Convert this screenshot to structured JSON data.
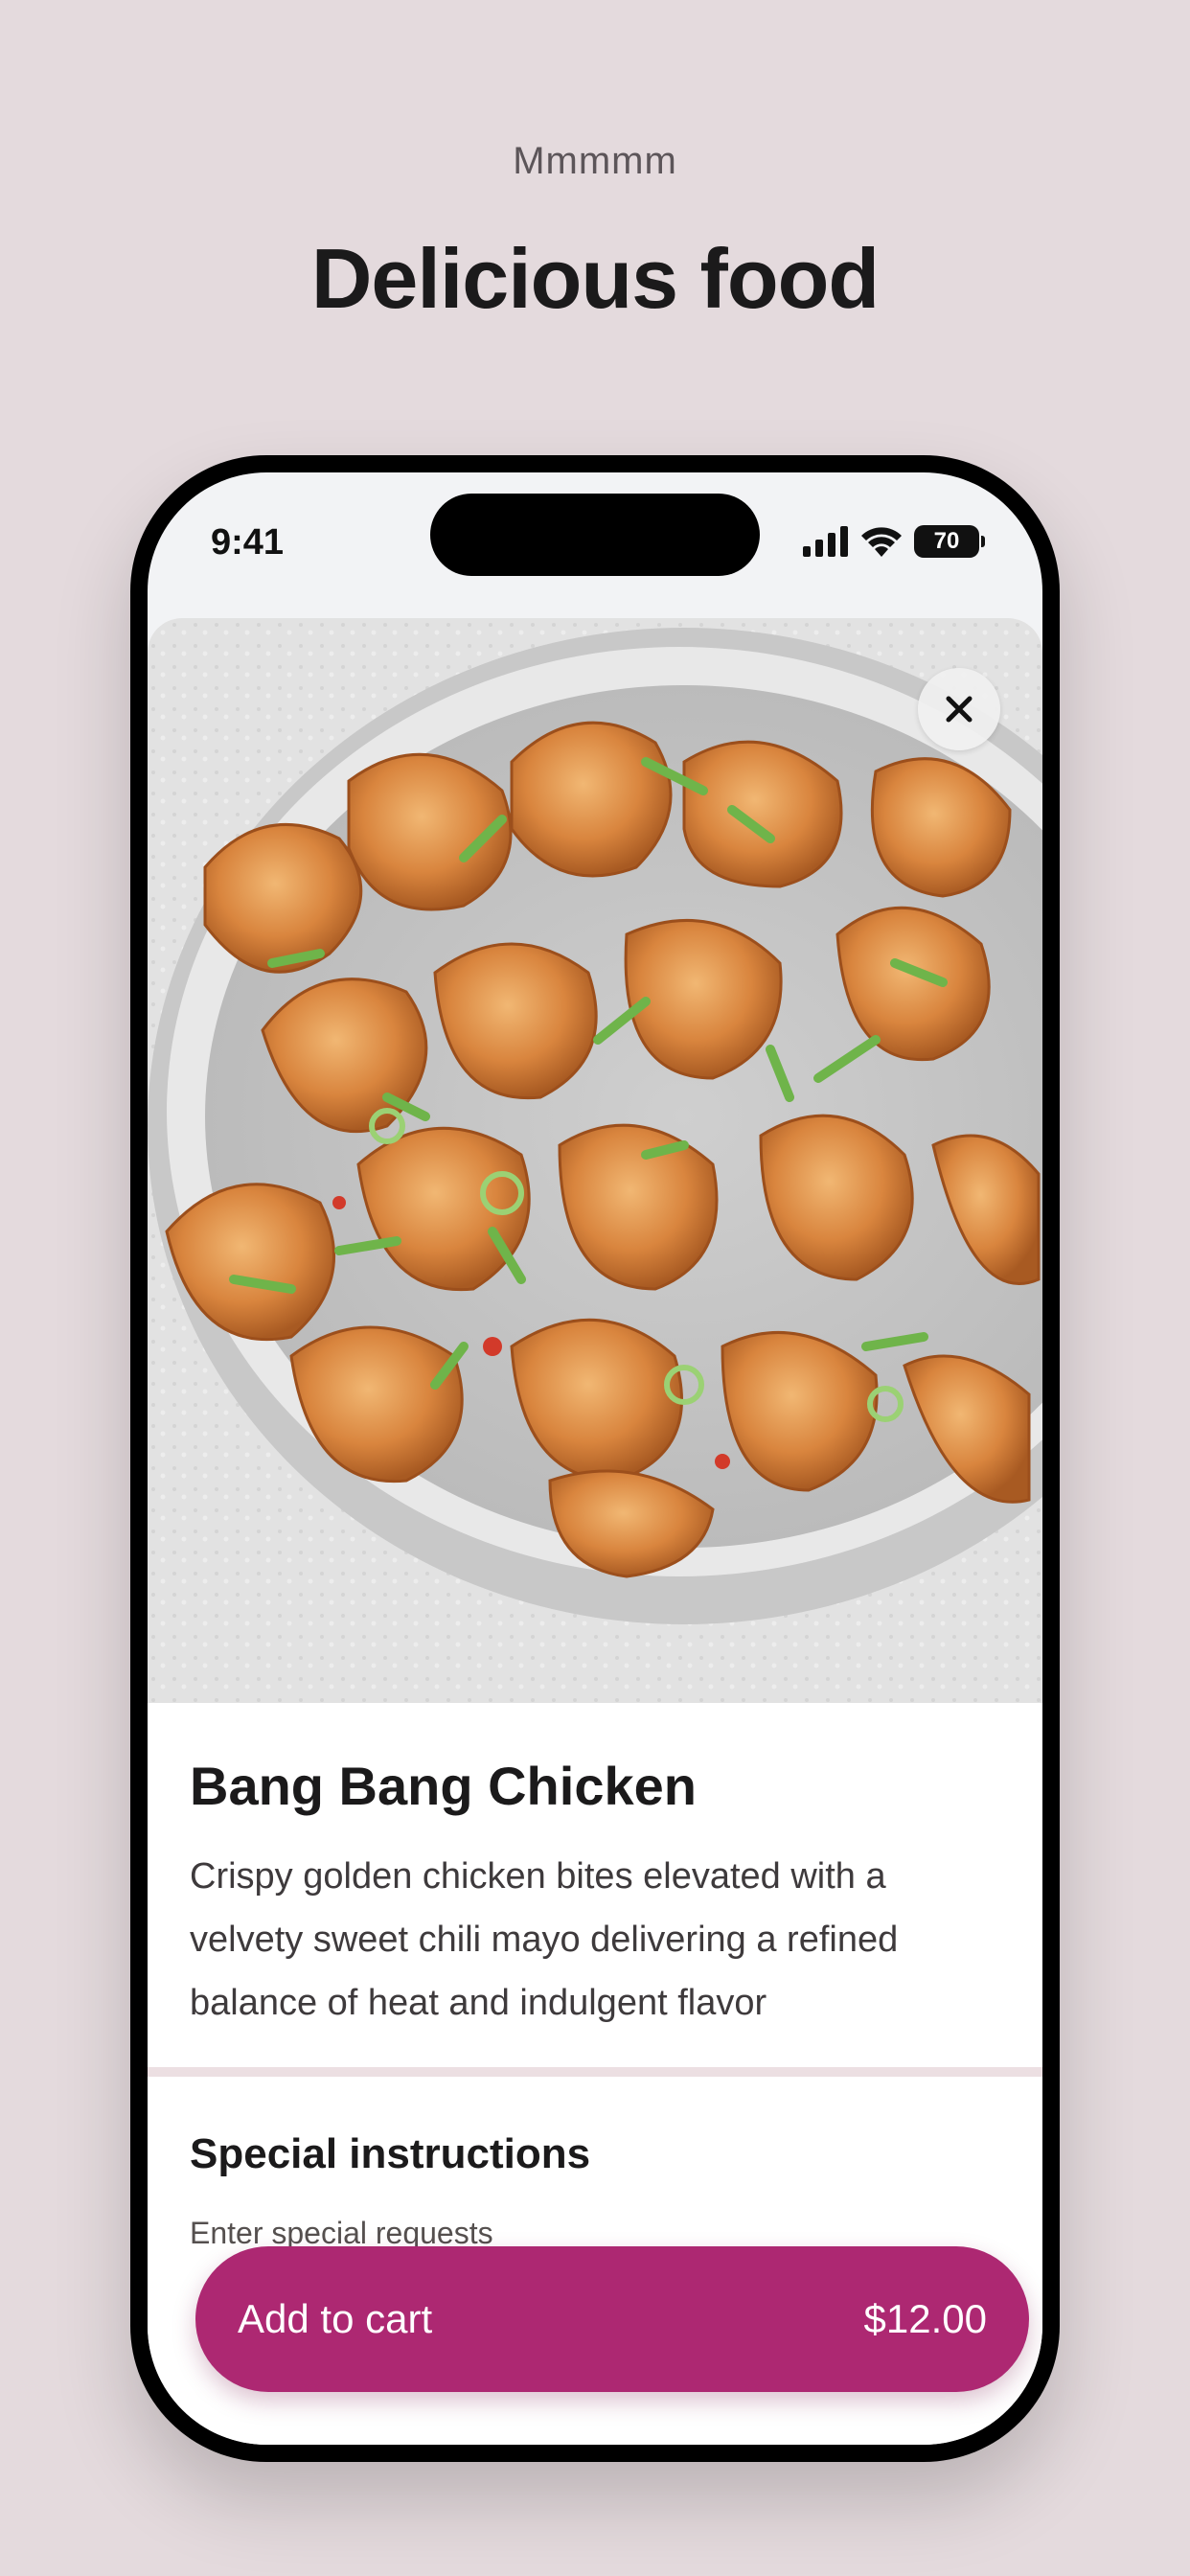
{
  "promo": {
    "eyebrow": "Mmmmm",
    "headline": "Delicious food"
  },
  "status_bar": {
    "time": "9:41",
    "battery": "70",
    "icons": [
      "cellular-signal-icon",
      "wifi-icon",
      "battery-icon"
    ]
  },
  "item": {
    "image_alt": "bowl of crispy chicken bites with sweet chili mayo and green onions",
    "title": "Bang Bang Chicken",
    "description": "Crispy golden chicken bites elevated with a velvety sweet chili mayo delivering a refined balance of heat and indulgent flavor"
  },
  "special_instructions": {
    "heading": "Special instructions",
    "placeholder": "Enter special requests",
    "value": ""
  },
  "cart": {
    "label": "Add to cart",
    "price": "$12.00"
  },
  "colors": {
    "background": "#e4dadd",
    "accent": "#ad2872",
    "divider": "#ecdfe2"
  }
}
